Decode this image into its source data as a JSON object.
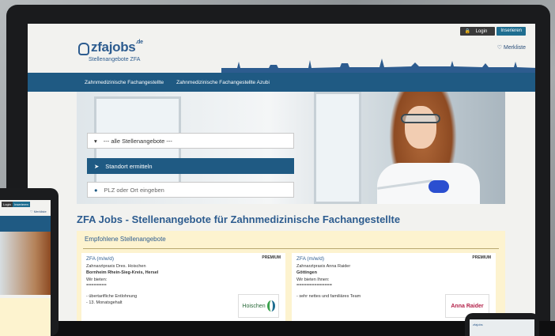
{
  "header": {
    "login_label": "Login",
    "insert_label": "Inserieren",
    "watchlist_label": "Merkliste",
    "logo_text": "zfajobs",
    "logo_tld": ".de",
    "logo_subtitle": "Stellenangebote ZFA"
  },
  "nav": {
    "items": [
      {
        "label": "Zahnmedizinische Fachangestellte"
      },
      {
        "label": "Zahnmedizinische Fachangestellte Azubi"
      }
    ]
  },
  "search": {
    "dropdown_value": "--- alle Stellenangebote ---",
    "locate_label": "Standort ermitteln",
    "zip_placeholder": "PLZ oder Ort eingeben"
  },
  "main": {
    "headline": "ZFA Jobs - Stellenangebote für Zahnmedizinische Fachangestellte",
    "featured_title": "Empfohlene Stellenangebote",
    "cards": [
      {
        "title": "ZFA (m/w/d)",
        "premium": "PREMIUM",
        "company": "Zahnarztpraxis Dres. Hoischen",
        "location": "Bornheim Rhein-Sieg-Kreis, Hersel",
        "intro": "Wir bieten:",
        "rule": "========",
        "bullet1": "- übertarifliche Entlohnung",
        "bullet2": "- 13. Monatsgehalt",
        "logo": "Hoischen"
      },
      {
        "title": "ZFA (m/w/d)",
        "premium": "PREMIUM",
        "company": "Zahnarztpraxis Anna Raider",
        "location": "Göttingen",
        "intro": "Wir bieten Ihnen:",
        "rule": "==============",
        "bullet1": "- sehr nettes und familiäres Team",
        "bullet2": "",
        "logo": "Anna Raider"
      }
    ]
  },
  "tablet": {
    "login_label": "Login",
    "insert_label": "Inserieren",
    "watchlist_label": "Merkliste"
  },
  "phone": {
    "logo_text": "zfajobs"
  },
  "colors": {
    "brand_blue": "#2d5c8f",
    "nav_blue": "#1f5a83",
    "panel_yellow": "#fdf3cf"
  }
}
